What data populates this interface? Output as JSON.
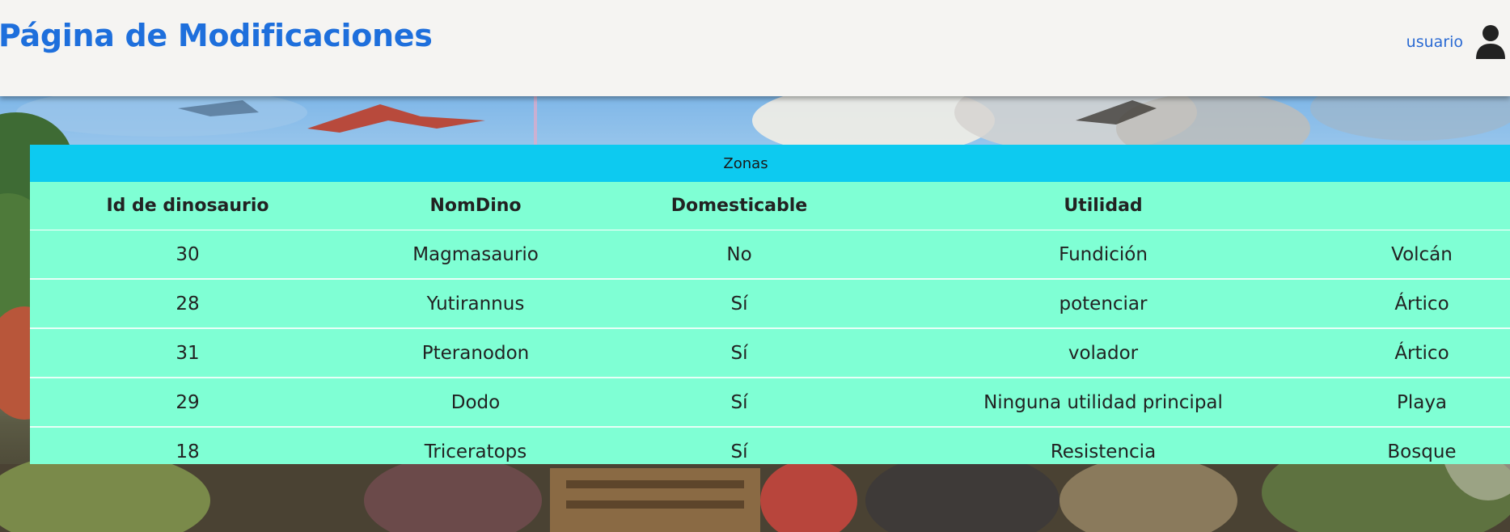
{
  "header": {
    "title": "Página de Modificaciones",
    "user_label": "usuario"
  },
  "icons": {
    "user": "user-silhouette-icon"
  },
  "colors": {
    "title": "#1e6fdc",
    "caption_bg": "#0dcaf0",
    "table_bg": "#7fffd4",
    "header_bg": "#f5f4f2"
  },
  "table": {
    "caption": "Zonas",
    "columns": [
      "Id de dinosaurio",
      "NomDino",
      "Domesticable",
      "Utilidad",
      ""
    ],
    "rows": [
      [
        "30",
        "Magmasaurio",
        "No",
        "Fundición",
        "Volcán"
      ],
      [
        "28",
        "Yutirannus",
        "Sí",
        "potenciar",
        "Ártico"
      ],
      [
        "31",
        "Pteranodon",
        "Sí",
        "volador",
        "Ártico"
      ],
      [
        "29",
        "Dodo",
        "Sí",
        "Ninguna utilidad principal",
        "Playa"
      ],
      [
        "18",
        "Triceratops",
        "Sí",
        "Resistencia",
        "Bosque"
      ]
    ]
  }
}
